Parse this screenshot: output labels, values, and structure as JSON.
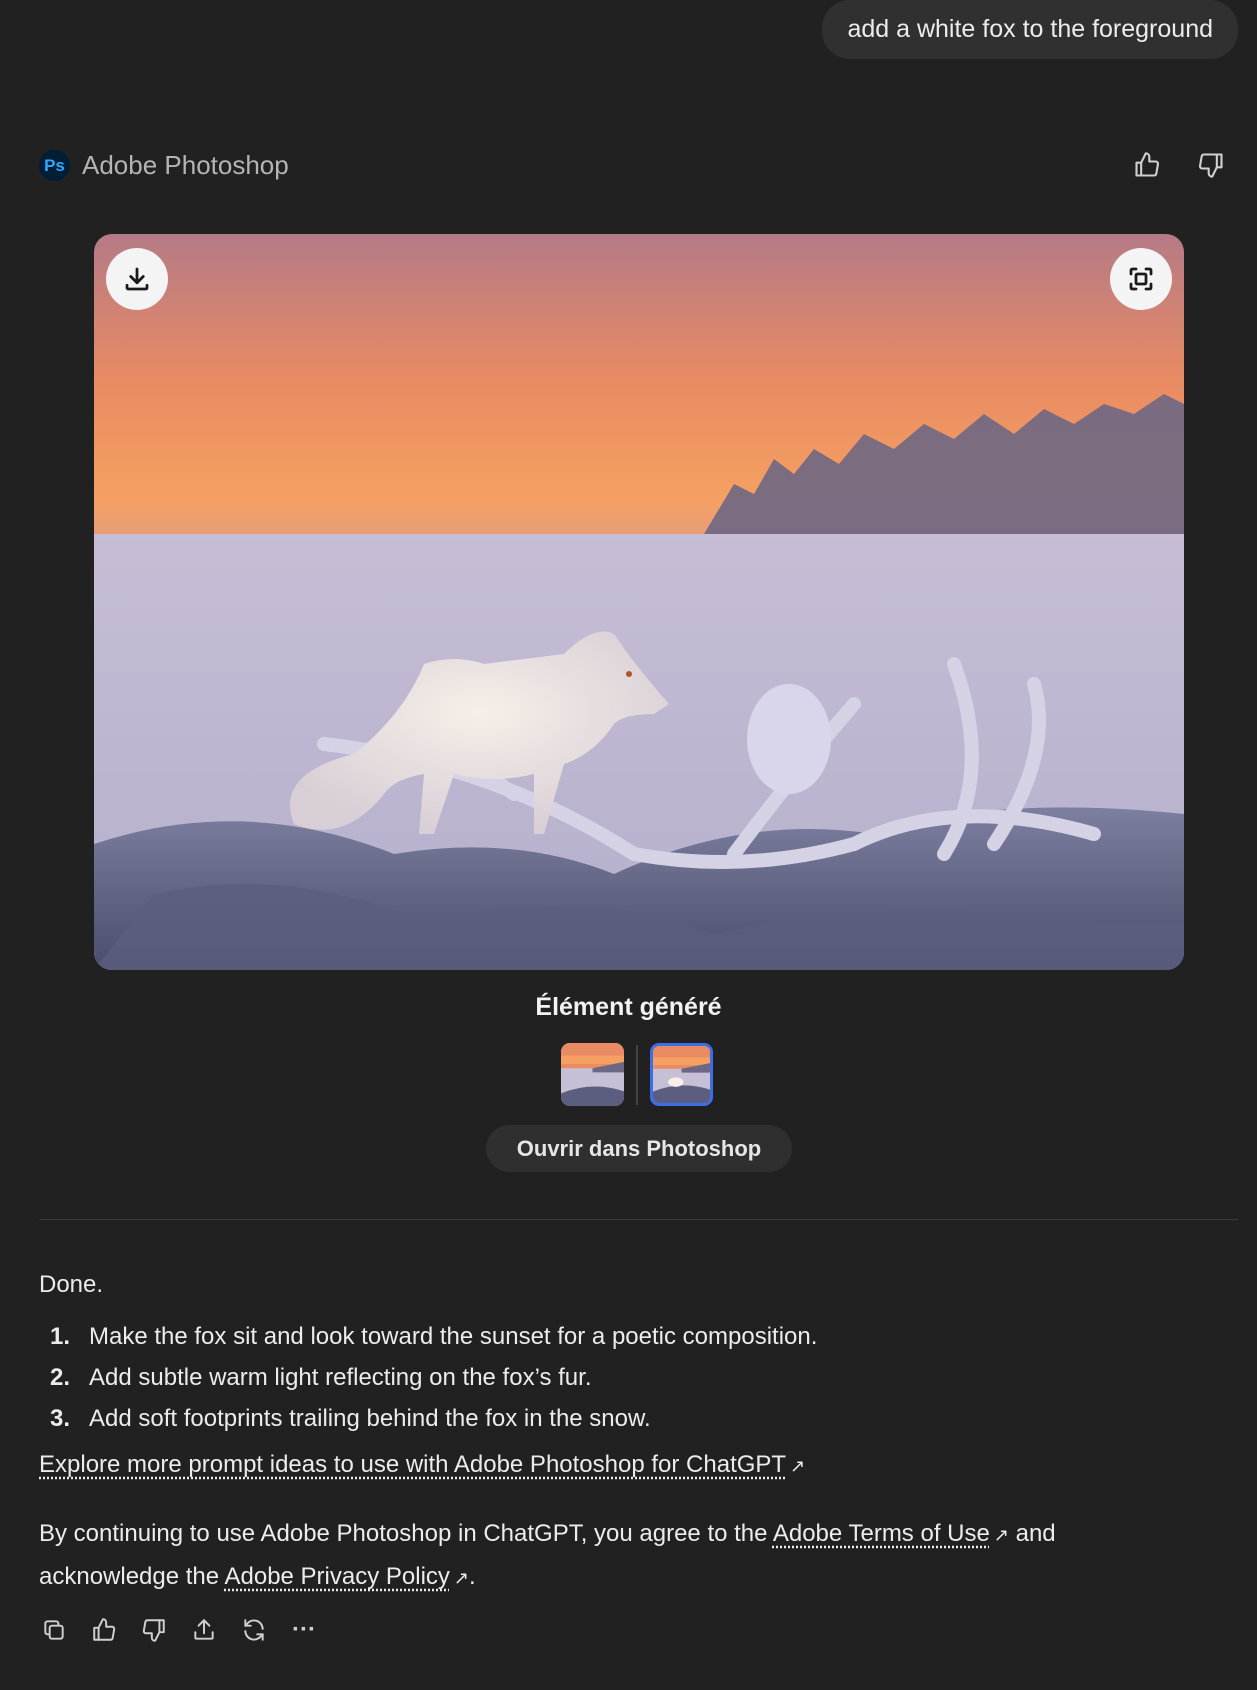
{
  "user_message": "add a white fox to the foreground",
  "app": {
    "logo_text": "Ps",
    "name": "Adobe Photoshop"
  },
  "icons": {
    "thumbs_up": "thumbs-up-icon",
    "thumbs_down": "thumbs-down-icon",
    "download": "download-icon",
    "expand": "expand-icon",
    "copy": "copy-icon",
    "share": "share-icon",
    "regenerate": "regenerate-icon",
    "more": "more-icon"
  },
  "generated": {
    "title": "Élément généré",
    "open_button": "Ouvrir dans Photoshop",
    "selected_thumbnail": 2
  },
  "response": {
    "intro": "Done.",
    "suggestions": [
      {
        "num": "1.",
        "text": "Make the fox sit and look toward the sunset for a poetic composition."
      },
      {
        "num": "2.",
        "text": "Add subtle warm light reflecting on the fox’s fur."
      },
      {
        "num": "3.",
        "text": "Add soft footprints trailing behind the fox in the snow."
      }
    ],
    "explore_link": "Explore more prompt ideas to use with Adobe Photoshop for ChatGPT",
    "legal_prefix": "By continuing to use Adobe Photoshop in ChatGPT, you agree to the",
    "terms_link": "Adobe Terms of Use",
    "legal_middle": "and acknowledge the",
    "privacy_link": "Adobe Privacy Policy",
    "legal_suffix": ".",
    "external_glyph": "↗",
    "more_glyph": "···"
  },
  "colors": {
    "accent": "#3c6ee8",
    "background": "#212121",
    "ps_blue": "#31a8ff"
  }
}
